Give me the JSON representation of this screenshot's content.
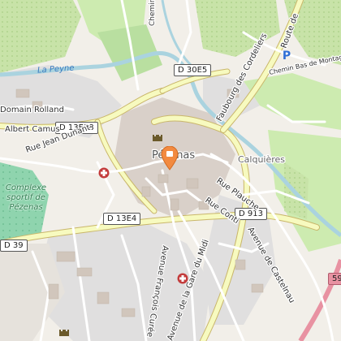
{
  "map": {
    "town_label": "Pézenas",
    "district_label": "Calquières",
    "water_label": "La Peyne",
    "parking_symbol": "P",
    "road_badges": [
      "D 30E5",
      "D 13E18",
      "D 13E4",
      "D 913",
      "D 39",
      "59"
    ],
    "street_labels": [
      "Faubourg des Cordeliers",
      "Route de",
      "Chemin Bas de Montagnac",
      "Domain Rolland",
      "Albert Camus",
      "Rue Jean Dunant",
      "Rue Plauche",
      "Rue Conti",
      "Avenue de Castelnau",
      "Avenue François Curée",
      "Avenue de la Gare du Midi",
      "Chemin"
    ],
    "poi_label": "Complexe sportif de Pézenas",
    "icons": [
      "castle-icon",
      "hospital-icon",
      "map-pin-icon",
      "parking-icon"
    ],
    "colors": {
      "background": "#f2efe9",
      "residential": "#e0dfdf",
      "water": "#aad3df",
      "vineyard": "#c8e3a8",
      "park": "#cdebb0",
      "primary_road": "#f7fabf",
      "secondary_road": "#ffffff",
      "pin": "#f28a40",
      "hospital": "#c33c3c",
      "motorway": "#e892a2"
    }
  }
}
